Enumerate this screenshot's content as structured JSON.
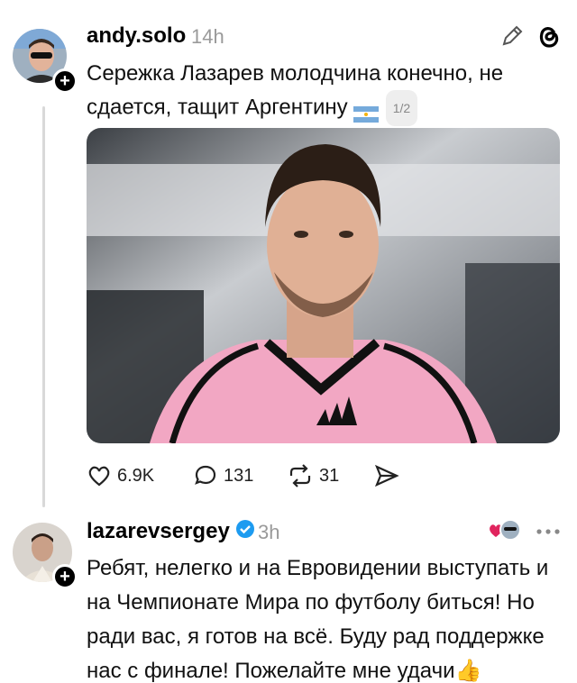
{
  "post1": {
    "username": "andy.solo",
    "time": "14h",
    "text_line1": "Сережка Лазарев молодчина конечно, не",
    "text_line2": "сдается, тащит Аргентину",
    "page_indicator": "1/2",
    "actions": {
      "likes": "6.9K",
      "comments": "131",
      "reposts": "31"
    }
  },
  "post2": {
    "username": "lazarevsergey",
    "time": "3h",
    "text": "Ребят, нелегко и на Евровидении выступать и на Чемпионате Мира по футболу биться! Но ради вас, я готов на всё. Буду рад поддержке нас с финале! Пожелайте мне удачи👍"
  },
  "icons": {
    "edit": "pencil-icon",
    "threads": "threads-logo-icon",
    "like": "heart-icon",
    "comment": "comment-icon",
    "repost": "repost-icon",
    "share": "send-icon",
    "more": "more-icon",
    "verified": "verified-badge-icon"
  },
  "colors": {
    "verified": "#1d9bf0",
    "jersey_pink": "#f2a7c3",
    "like_red": "#e0245e"
  }
}
